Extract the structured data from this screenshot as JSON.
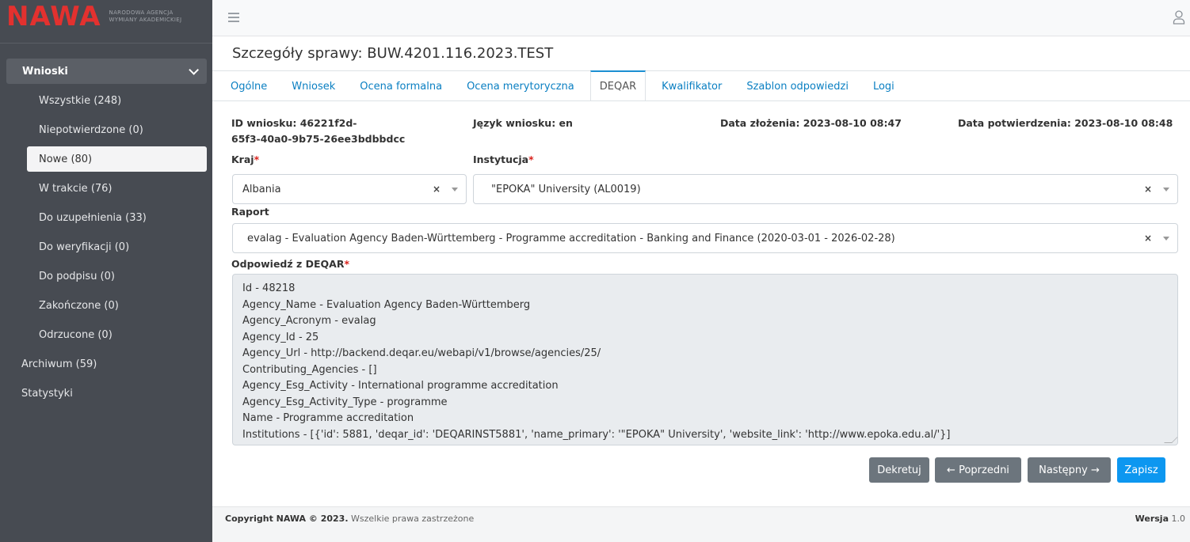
{
  "logo": {
    "text": "NAWA",
    "sub_line1": "NARODOWA AGENCJA",
    "sub_line2": "WYMIANY AKADEMICKIEJ"
  },
  "sidebar": {
    "group_label": "Wnioski",
    "items": [
      {
        "label": "Wszystkie (248)"
      },
      {
        "label": "Niepotwierdzone (0)"
      },
      {
        "label": "Nowe (80)"
      },
      {
        "label": "W trakcie (76)"
      },
      {
        "label": "Do uzupełnienia (33)"
      },
      {
        "label": "Do weryfikacji (0)"
      },
      {
        "label": "Do podpisu (0)"
      },
      {
        "label": "Zakończone (0)"
      },
      {
        "label": "Odrzucone (0)"
      }
    ],
    "top_items": [
      {
        "label": "Archiwum (59)"
      },
      {
        "label": "Statystyki"
      }
    ]
  },
  "page": {
    "title": "Szczegóły sprawy: BUW.4201.116.2023.TEST"
  },
  "tabs": [
    {
      "label": "Ogólne"
    },
    {
      "label": "Wniosek"
    },
    {
      "label": "Ocena formalna"
    },
    {
      "label": "Ocena merytoryczna"
    },
    {
      "label": "DEQAR"
    },
    {
      "label": "Kwalifikator"
    },
    {
      "label": "Szablon odpowiedzi"
    },
    {
      "label": "Logi"
    }
  ],
  "info": {
    "id_line1": "ID wniosku: 46221f2d-",
    "id_line2": "65f3-40a0-9b75-26ee3bdbbdcc",
    "language": "Język wniosku: en",
    "submitted": "Data złożenia: 2023-08-10 08:47",
    "confirmed": "Data potwierdzenia: 2023-08-10 08:48"
  },
  "form": {
    "country_label": "Kraj",
    "country_value": "Albania",
    "institution_label": "Instytucja",
    "institution_value": "\"EPOKA\" University (AL0019)",
    "report_label": "Raport",
    "report_value": "evalag - Evaluation Agency Baden-Württemberg - Programme accreditation - Banking and Finance (2020-03-01 - 2026-02-28)",
    "response_label": "Odpowiedź z DEQAR",
    "required_mark": "*",
    "clear_symbol": "×",
    "response_lines": [
      "Id - 48218",
      "Agency_Name - Evaluation Agency Baden-Württemberg",
      "Agency_Acronym - evalag",
      "Agency_Id - 25",
      "Agency_Url - http://backend.deqar.eu/webapi/v1/browse/agencies/25/",
      "Contributing_Agencies - []",
      "Agency_Esg_Activity - International programme accreditation",
      "Agency_Esg_Activity_Type - programme",
      "Name - Programme accreditation",
      "Institutions - [{'id': 5881, 'deqar_id': 'DEQARINST5881', 'name_primary': '\"EPOKA\" University', 'website_link': 'http://www.epoka.edu.al/'}]"
    ]
  },
  "buttons": {
    "dekretuj": "Dekretuj",
    "previous": "← Poprzedni",
    "next": "Następny →",
    "save": "Zapisz"
  },
  "footer": {
    "copyright_bold": "Copyright NAWA © 2023.",
    "copyright_rest": " Wszelkie prawa zastrzeżone",
    "version_label": "Wersja",
    "version_value": " 1.0"
  },
  "colors": {
    "sidebar_bg": "#474b52",
    "accent": "#0d97f0",
    "link": "#0a7fc2",
    "logo_red": "#e3312f"
  }
}
